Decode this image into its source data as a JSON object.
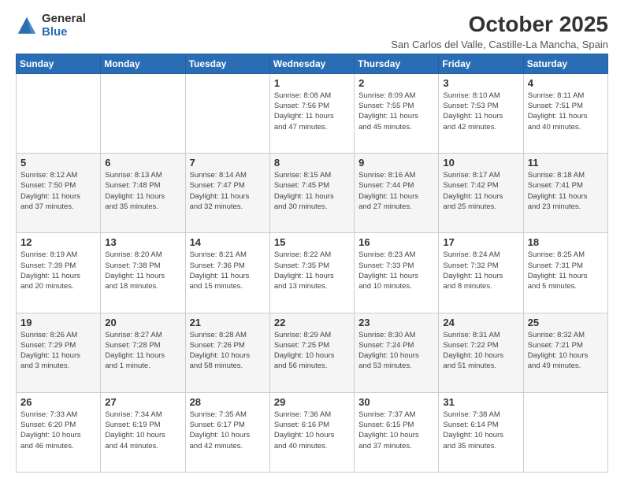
{
  "logo": {
    "general": "General",
    "blue": "Blue"
  },
  "header": {
    "month": "October 2025",
    "location": "San Carlos del Valle, Castille-La Mancha, Spain"
  },
  "weekdays": [
    "Sunday",
    "Monday",
    "Tuesday",
    "Wednesday",
    "Thursday",
    "Friday",
    "Saturday"
  ],
  "weeks": [
    [
      {
        "day": "",
        "info": ""
      },
      {
        "day": "",
        "info": ""
      },
      {
        "day": "",
        "info": ""
      },
      {
        "day": "1",
        "info": "Sunrise: 8:08 AM\nSunset: 7:56 PM\nDaylight: 11 hours\nand 47 minutes."
      },
      {
        "day": "2",
        "info": "Sunrise: 8:09 AM\nSunset: 7:55 PM\nDaylight: 11 hours\nand 45 minutes."
      },
      {
        "day": "3",
        "info": "Sunrise: 8:10 AM\nSunset: 7:53 PM\nDaylight: 11 hours\nand 42 minutes."
      },
      {
        "day": "4",
        "info": "Sunrise: 8:11 AM\nSunset: 7:51 PM\nDaylight: 11 hours\nand 40 minutes."
      }
    ],
    [
      {
        "day": "5",
        "info": "Sunrise: 8:12 AM\nSunset: 7:50 PM\nDaylight: 11 hours\nand 37 minutes."
      },
      {
        "day": "6",
        "info": "Sunrise: 8:13 AM\nSunset: 7:48 PM\nDaylight: 11 hours\nand 35 minutes."
      },
      {
        "day": "7",
        "info": "Sunrise: 8:14 AM\nSunset: 7:47 PM\nDaylight: 11 hours\nand 32 minutes."
      },
      {
        "day": "8",
        "info": "Sunrise: 8:15 AM\nSunset: 7:45 PM\nDaylight: 11 hours\nand 30 minutes."
      },
      {
        "day": "9",
        "info": "Sunrise: 8:16 AM\nSunset: 7:44 PM\nDaylight: 11 hours\nand 27 minutes."
      },
      {
        "day": "10",
        "info": "Sunrise: 8:17 AM\nSunset: 7:42 PM\nDaylight: 11 hours\nand 25 minutes."
      },
      {
        "day": "11",
        "info": "Sunrise: 8:18 AM\nSunset: 7:41 PM\nDaylight: 11 hours\nand 23 minutes."
      }
    ],
    [
      {
        "day": "12",
        "info": "Sunrise: 8:19 AM\nSunset: 7:39 PM\nDaylight: 11 hours\nand 20 minutes."
      },
      {
        "day": "13",
        "info": "Sunrise: 8:20 AM\nSunset: 7:38 PM\nDaylight: 11 hours\nand 18 minutes."
      },
      {
        "day": "14",
        "info": "Sunrise: 8:21 AM\nSunset: 7:36 PM\nDaylight: 11 hours\nand 15 minutes."
      },
      {
        "day": "15",
        "info": "Sunrise: 8:22 AM\nSunset: 7:35 PM\nDaylight: 11 hours\nand 13 minutes."
      },
      {
        "day": "16",
        "info": "Sunrise: 8:23 AM\nSunset: 7:33 PM\nDaylight: 11 hours\nand 10 minutes."
      },
      {
        "day": "17",
        "info": "Sunrise: 8:24 AM\nSunset: 7:32 PM\nDaylight: 11 hours\nand 8 minutes."
      },
      {
        "day": "18",
        "info": "Sunrise: 8:25 AM\nSunset: 7:31 PM\nDaylight: 11 hours\nand 5 minutes."
      }
    ],
    [
      {
        "day": "19",
        "info": "Sunrise: 8:26 AM\nSunset: 7:29 PM\nDaylight: 11 hours\nand 3 minutes."
      },
      {
        "day": "20",
        "info": "Sunrise: 8:27 AM\nSunset: 7:28 PM\nDaylight: 11 hours\nand 1 minute."
      },
      {
        "day": "21",
        "info": "Sunrise: 8:28 AM\nSunset: 7:26 PM\nDaylight: 10 hours\nand 58 minutes."
      },
      {
        "day": "22",
        "info": "Sunrise: 8:29 AM\nSunset: 7:25 PM\nDaylight: 10 hours\nand 56 minutes."
      },
      {
        "day": "23",
        "info": "Sunrise: 8:30 AM\nSunset: 7:24 PM\nDaylight: 10 hours\nand 53 minutes."
      },
      {
        "day": "24",
        "info": "Sunrise: 8:31 AM\nSunset: 7:22 PM\nDaylight: 10 hours\nand 51 minutes."
      },
      {
        "day": "25",
        "info": "Sunrise: 8:32 AM\nSunset: 7:21 PM\nDaylight: 10 hours\nand 49 minutes."
      }
    ],
    [
      {
        "day": "26",
        "info": "Sunrise: 7:33 AM\nSunset: 6:20 PM\nDaylight: 10 hours\nand 46 minutes."
      },
      {
        "day": "27",
        "info": "Sunrise: 7:34 AM\nSunset: 6:19 PM\nDaylight: 10 hours\nand 44 minutes."
      },
      {
        "day": "28",
        "info": "Sunrise: 7:35 AM\nSunset: 6:17 PM\nDaylight: 10 hours\nand 42 minutes."
      },
      {
        "day": "29",
        "info": "Sunrise: 7:36 AM\nSunset: 6:16 PM\nDaylight: 10 hours\nand 40 minutes."
      },
      {
        "day": "30",
        "info": "Sunrise: 7:37 AM\nSunset: 6:15 PM\nDaylight: 10 hours\nand 37 minutes."
      },
      {
        "day": "31",
        "info": "Sunrise: 7:38 AM\nSunset: 6:14 PM\nDaylight: 10 hours\nand 35 minutes."
      },
      {
        "day": "",
        "info": ""
      }
    ]
  ]
}
